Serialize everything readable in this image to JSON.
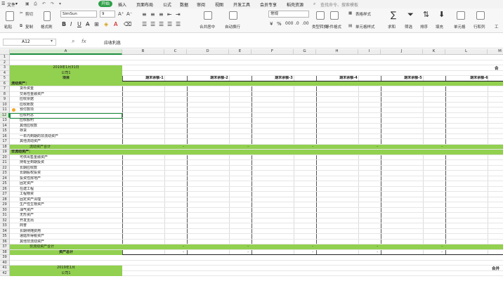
{
  "menu": {
    "file": "文件",
    "tabs": [
      "开始",
      "插入",
      "页面布局",
      "公式",
      "数据",
      "审阅",
      "视图",
      "开发工具",
      "会员专享",
      "稻壳资源"
    ],
    "search_placeholder": "查找命令、搜索模板"
  },
  "toolbar": {
    "paste": "粘贴",
    "cut": "剪切",
    "copy": "复制",
    "format_painter": "格式刷",
    "font_name": "SimSun",
    "font_size": "9",
    "merge_center": "合并居中",
    "wrap_text": "自动换行",
    "number_format": "常规",
    "type_convert": "类型转换",
    "conditional_format": "条件格式",
    "table_style": "表格样式",
    "cell_style": "单元格样式",
    "sum": "求和",
    "filter": "筛选",
    "sort": "排序",
    "fill": "填充",
    "cell": "单元格",
    "rows_cols": "行和列",
    "worksheet": "工"
  },
  "formula_bar": {
    "name_box": "A12",
    "fx": "fx",
    "content": "应收利息"
  },
  "columns": [
    "A",
    "B",
    "C",
    "D",
    "E",
    "F",
    "G",
    "H",
    "I",
    "J",
    "K",
    "L",
    "M"
  ],
  "rows": [
    {
      "n": "1",
      "a": ""
    },
    {
      "n": "2",
      "a": ""
    },
    {
      "n": "3",
      "a": "2019年1月31日",
      "kind": "green-a"
    },
    {
      "n": "4",
      "a": "公司1",
      "kind": "green-a"
    },
    {
      "n": "5",
      "a": "项目",
      "kind": "header"
    },
    {
      "n": "6",
      "a": "流动资产：",
      "kind": "section"
    },
    {
      "n": "7",
      "a": "货币资金"
    },
    {
      "n": "8",
      "a": "交易性金融资产"
    },
    {
      "n": "9",
      "a": "应收票据"
    },
    {
      "n": "10",
      "a": "应收账款"
    },
    {
      "n": "11",
      "a": "预付款项"
    },
    {
      "n": "12",
      "a": "应收利息",
      "selected": true
    },
    {
      "n": "13",
      "a": "应收股利"
    },
    {
      "n": "14",
      "a": "其他应收款"
    },
    {
      "n": "15",
      "a": "存货"
    },
    {
      "n": "16",
      "a": "一年内到期的非流动资产"
    },
    {
      "n": "17",
      "a": "其他流动资产"
    },
    {
      "n": "18",
      "a": "流动资产合计",
      "kind": "total"
    },
    {
      "n": "19",
      "a": "非流动资产：",
      "kind": "section"
    },
    {
      "n": "20",
      "a": "可供出售金融资产"
    },
    {
      "n": "21",
      "a": "持有至到期投资"
    },
    {
      "n": "22",
      "a": "长期应收款"
    },
    {
      "n": "23",
      "a": "长期股权投资"
    },
    {
      "n": "24",
      "a": "投资性房地产"
    },
    {
      "n": "25",
      "a": "固定资产"
    },
    {
      "n": "26",
      "a": "在建工程"
    },
    {
      "n": "27",
      "a": "工程物资"
    },
    {
      "n": "28",
      "a": "固定资产清理"
    },
    {
      "n": "29",
      "a": "生产性生物资产"
    },
    {
      "n": "30",
      "a": "油气资产"
    },
    {
      "n": "31",
      "a": "无形资产"
    },
    {
      "n": "32",
      "a": "开发支出"
    },
    {
      "n": "33",
      "a": "商誉"
    },
    {
      "n": "34",
      "a": "长期待摊费用"
    },
    {
      "n": "35",
      "a": "递延所得税资产"
    },
    {
      "n": "36",
      "a": "其他非流动资产"
    },
    {
      "n": "37",
      "a": "非流动资产合计",
      "kind": "total"
    },
    {
      "n": "38",
      "a": "资产总计",
      "kind": "grand"
    },
    {
      "n": "39",
      "a": ""
    },
    {
      "n": "40",
      "a": ""
    },
    {
      "n": "41",
      "a": "2019年1月",
      "kind": "green-a"
    },
    {
      "n": "42",
      "a": "公司1",
      "kind": "green-a"
    }
  ],
  "period_headers": [
    "期末余额-1",
    "期末余额-2",
    "期末余额-3",
    "期末余额-4",
    "期末余额-5",
    "期末余额-6"
  ],
  "dash": "-",
  "right_edge_label": "合",
  "right_edge_label_2": "合并"
}
